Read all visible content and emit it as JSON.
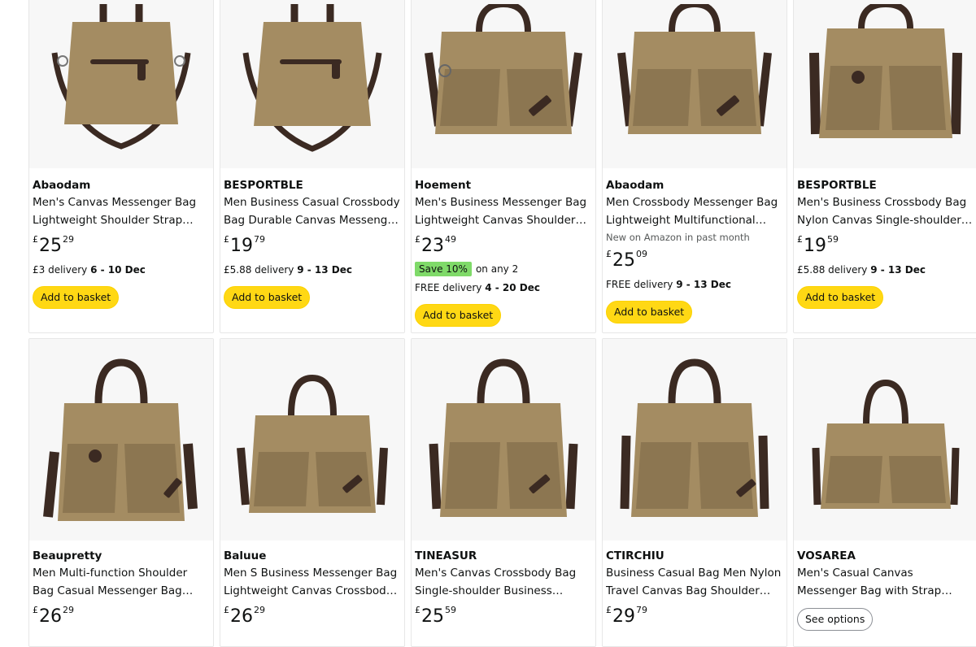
{
  "products": [
    {
      "brand": "Abaodam",
      "title": "Men's Canvas Messenger Bag Lightweight Shoulder Strap Business Briefcase",
      "new_on": "",
      "currency": "£",
      "price_whole": "25",
      "price_fraction": "29",
      "save_badge": "",
      "save_text": "",
      "delivery_prefix": "£3 delivery",
      "delivery_dates": "6 - 10 Dec",
      "button": "Add to basket",
      "image_icon": "bag-zip-icon"
    },
    {
      "brand": "BESPORTBLE",
      "title": "Men Business Casual Crossbody Bag Durable Canvas Messenger Bag",
      "new_on": "",
      "currency": "£",
      "price_whole": "19",
      "price_fraction": "79",
      "save_badge": "",
      "save_text": "",
      "delivery_prefix": "£5.88 delivery",
      "delivery_dates": "9 - 13 Dec",
      "button": "Add to basket",
      "image_icon": "bag-zip-icon"
    },
    {
      "brand": "Hoement",
      "title": "Men's Business Messenger Bag Lightweight Canvas Shoulder Bag",
      "new_on": "",
      "currency": "£",
      "price_whole": "23",
      "price_fraction": "49",
      "save_badge": "Save 10%",
      "save_text": "on any 2",
      "delivery_prefix": "FREE delivery",
      "delivery_dates": "4 - 20 Dec",
      "button": "Add to basket",
      "image_icon": "bag-pocket-icon"
    },
    {
      "brand": "Abaodam",
      "title": "Men Crossbody Messenger Bag Lightweight Multifunctional Shoulder Bag",
      "new_on": "New on Amazon in past month",
      "currency": "£",
      "price_whole": "25",
      "price_fraction": "09",
      "save_badge": "",
      "save_text": "",
      "delivery_prefix": "FREE delivery",
      "delivery_dates": "9 - 13 Dec",
      "button": "Add to basket",
      "image_icon": "bag-pocket-icon"
    },
    {
      "brand": "BESPORTBLE",
      "title": "Men's Business Crossbody Bag Nylon Canvas Single-shoulder Bag",
      "new_on": "",
      "currency": "£",
      "price_whole": "19",
      "price_fraction": "59",
      "save_badge": "",
      "save_text": "",
      "delivery_prefix": "£5.88 delivery",
      "delivery_dates": "9 - 13 Dec",
      "button": "Add to basket",
      "image_icon": "bag-pocket-icon"
    },
    {
      "brand": "Beaupretty",
      "title": "Men Multi-function Shoulder Bag Casual Messenger Bag Handbag",
      "new_on": "",
      "currency": "£",
      "price_whole": "26",
      "price_fraction": "29",
      "save_badge": "",
      "save_text": "",
      "delivery_prefix": "",
      "delivery_dates": "",
      "button": "",
      "image_icon": "bag-pocket-icon"
    },
    {
      "brand": "Baluue",
      "title": "Men S Business Messenger Bag Lightweight Canvas Crossbody Bag",
      "new_on": "",
      "currency": "£",
      "price_whole": "26",
      "price_fraction": "29",
      "save_badge": "",
      "save_text": "",
      "delivery_prefix": "",
      "delivery_dates": "",
      "button": "",
      "image_icon": "bag-pocket-icon"
    },
    {
      "brand": "TINEASUR",
      "title": "Men's Canvas Crossbody Bag Single-shoulder Business Handbag",
      "new_on": "",
      "currency": "£",
      "price_whole": "25",
      "price_fraction": "59",
      "save_badge": "",
      "save_text": "",
      "delivery_prefix": "",
      "delivery_dates": "",
      "button": "",
      "image_icon": "bag-pocket-icon"
    },
    {
      "brand": "CTIRCHIU",
      "title": "Business Casual Bag Men Nylon Travel Canvas Bag Shoulder Bag",
      "new_on": "",
      "currency": "£",
      "price_whole": "29",
      "price_fraction": "79",
      "save_badge": "",
      "save_text": "",
      "delivery_prefix": "",
      "delivery_dates": "",
      "button": "",
      "image_icon": "bag-pocket-icon"
    },
    {
      "brand": "VOSAREA",
      "title": "Men's Casual Canvas Messenger Bag with Strap Multipurpose Handbag",
      "new_on": "",
      "currency": "",
      "price_whole": "",
      "price_fraction": "",
      "save_badge": "",
      "save_text": "",
      "delivery_prefix": "",
      "delivery_dates": "",
      "button": "See options",
      "image_icon": "bag-pocket-icon"
    }
  ],
  "colors": {
    "canvas": "#a48c62",
    "canvas_dark": "#8c7651",
    "leather": "#3b2a22",
    "button_yellow": "#ffd814",
    "save_green": "#7fda69"
  }
}
